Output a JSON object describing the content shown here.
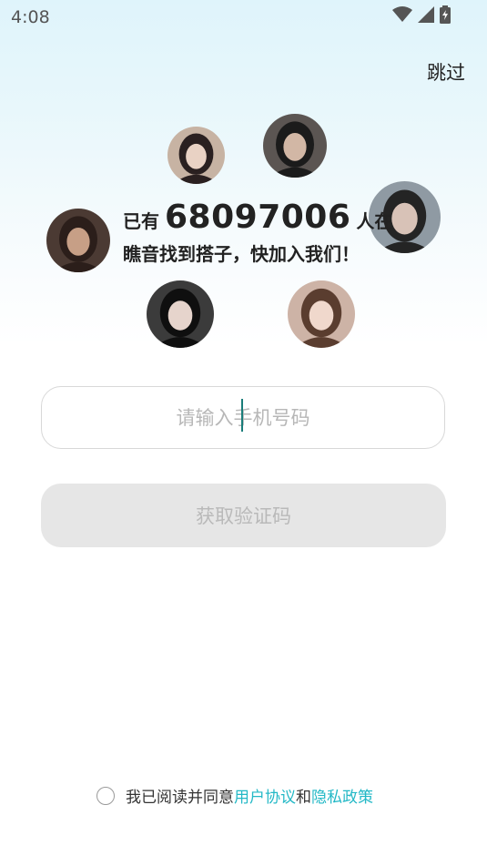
{
  "status_bar": {
    "time": "4:08",
    "icons": [
      "wifi-icon",
      "cellular-signal-icon",
      "battery-charging-icon"
    ]
  },
  "header": {
    "skip_label": "跳过"
  },
  "headline": {
    "prefix": "已有",
    "count": "68097006",
    "suffix": "人在",
    "subtitle": "瞧音找到搭子，快加入我们！"
  },
  "avatars": [
    {
      "id": "avatar-1",
      "palette": [
        "#c7b3a3",
        "#2a2020",
        "#e9d2c4"
      ]
    },
    {
      "id": "avatar-2",
      "palette": [
        "#5b5552",
        "#1b1b1b",
        "#d2b7a5"
      ]
    },
    {
      "id": "avatar-3",
      "palette": [
        "#4b3a33",
        "#2b1e1a",
        "#c79f86"
      ]
    },
    {
      "id": "avatar-4",
      "palette": [
        "#8f9aa3",
        "#242424",
        "#d8c2b7"
      ]
    },
    {
      "id": "avatar-5",
      "palette": [
        "#3b3b3b",
        "#0f0f0f",
        "#e6d4cc"
      ]
    },
    {
      "id": "avatar-6",
      "palette": [
        "#cdb3a6",
        "#5a3d2f",
        "#f0d8cc"
      ]
    }
  ],
  "form": {
    "phone_placeholder": "请输入手机号码",
    "phone_value": "",
    "code_button_label": "获取验证码"
  },
  "agreement": {
    "prefix": "我已阅读并同意",
    "user_agreement": "用户协议",
    "and": "和",
    "privacy_policy": "隐私政策",
    "link_color": "#23b8c6"
  }
}
